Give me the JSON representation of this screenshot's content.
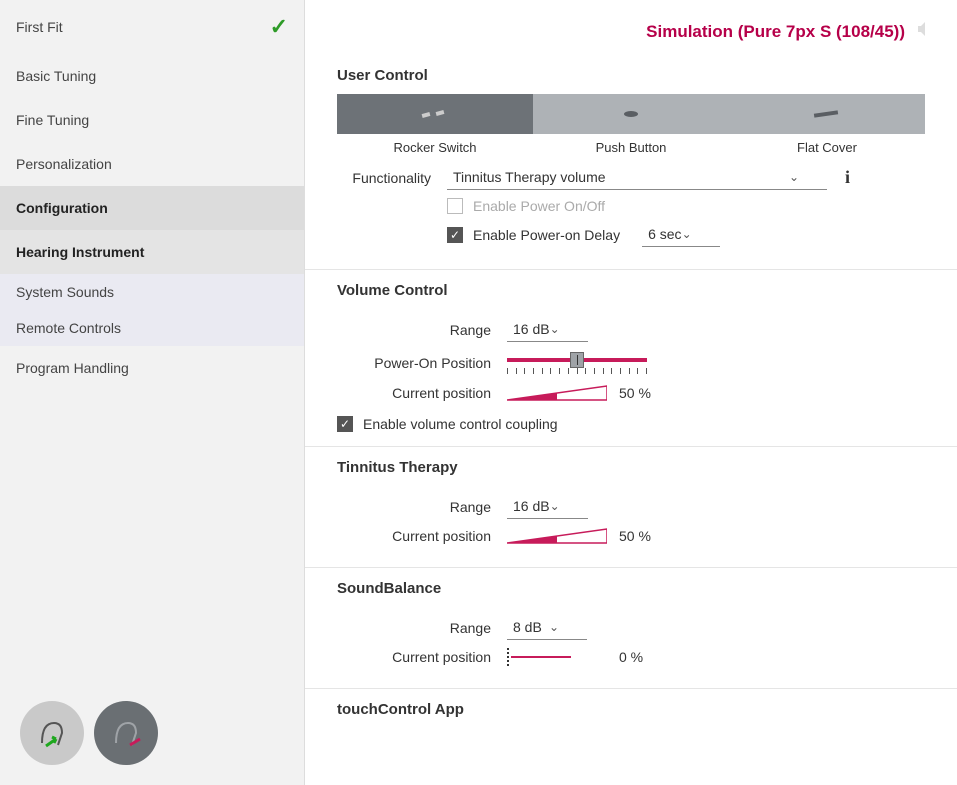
{
  "header": {
    "title": "Simulation (Pure 7px S (108/45))"
  },
  "sidebar": {
    "items": [
      {
        "label": "First Fit",
        "checked": true
      },
      {
        "label": "Basic Tuning"
      },
      {
        "label": "Fine Tuning"
      },
      {
        "label": "Personalization"
      },
      {
        "label": "Configuration",
        "bold": true
      },
      {
        "label": "Hearing Instrument",
        "selected": true
      },
      {
        "label": "System Sounds",
        "sub": true
      },
      {
        "label": "Remote Controls",
        "sub": true
      },
      {
        "label": "Program Handling"
      }
    ]
  },
  "user_control": {
    "heading": "User Control",
    "tabs": [
      "Rocker Switch",
      "Push Button",
      "Flat Cover"
    ],
    "functionality_label": "Functionality",
    "functionality_value": "Tinnitus Therapy volume",
    "enable_power_onoff": "Enable Power On/Off",
    "enable_power_on_delay": "Enable Power-on Delay",
    "delay_value": "6 sec"
  },
  "volume_control": {
    "heading": "Volume Control",
    "range_label": "Range",
    "range_value": "16 dB",
    "power_on_label": "Power-On Position",
    "current_label": "Current position",
    "current_value": "50 %",
    "coupling_label": "Enable volume control coupling"
  },
  "tinnitus": {
    "heading": "Tinnitus Therapy",
    "range_label": "Range",
    "range_value": "16 dB",
    "current_label": "Current position",
    "current_value": "50 %"
  },
  "sound_balance": {
    "heading": "SoundBalance",
    "range_label": "Range",
    "range_value": "8 dB",
    "current_label": "Current position",
    "current_value": "0 %"
  },
  "touch_control": {
    "heading": "touchControl App"
  }
}
